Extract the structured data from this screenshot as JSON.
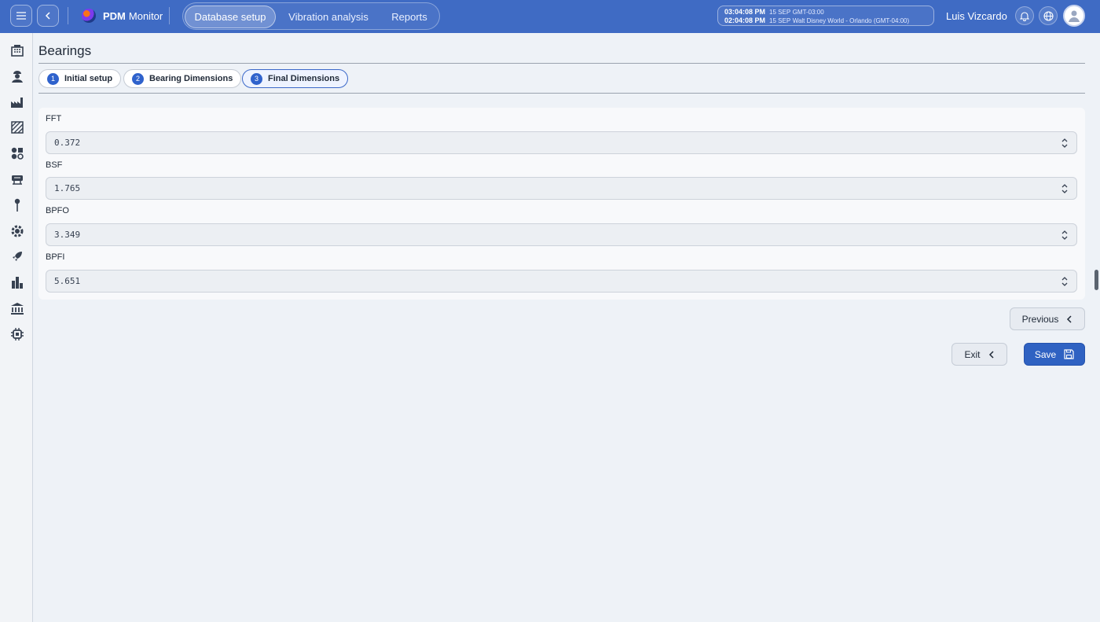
{
  "topbar": {
    "brand_bold": "PDM",
    "brand_rest": "Monitor",
    "tabs": [
      {
        "label": "Database setup",
        "active": true
      },
      {
        "label": "Vibration analysis",
        "active": false
      },
      {
        "label": "Reports",
        "active": false
      }
    ],
    "clock": {
      "line1_time": "03:04:08 PM",
      "line1_date": "15 SEP",
      "line1_zone": "GMT-03:00",
      "line2_time": "02:04:08 PM",
      "line2_date": "15 SEP",
      "line2_zone": "Walt Disney World - Orlando (GMT-04:00)"
    },
    "user_name": "Luis Vizcardo"
  },
  "sidebar": {
    "icons": [
      "building-icon",
      "operator-icon",
      "factory-icon",
      "area-icon",
      "components-icon",
      "machine-icon",
      "sensor-pin-icon",
      "gear-icon",
      "rocket-icon",
      "bar-chart-icon",
      "bank-icon",
      "chip-icon"
    ]
  },
  "page": {
    "title": "Bearings",
    "steps": [
      {
        "num": "1",
        "label": "Initial setup",
        "active": false
      },
      {
        "num": "2",
        "label": "Bearing Dimensions",
        "active": false
      },
      {
        "num": "3",
        "label": "Final Dimensions",
        "active": true
      }
    ]
  },
  "form": {
    "fields": [
      {
        "label": "FFT",
        "value": "0.372"
      },
      {
        "label": "BSF",
        "value": "1.765"
      },
      {
        "label": "BPFO",
        "value": "3.349"
      },
      {
        "label": "BPFI",
        "value": "5.651"
      }
    ]
  },
  "actions": {
    "previous_label": "Previous",
    "exit_label": "Exit",
    "save_label": "Save"
  },
  "colors": {
    "topbar": "#3f6bc4",
    "primary": "#2f62c2",
    "background": "#eef2f7"
  }
}
